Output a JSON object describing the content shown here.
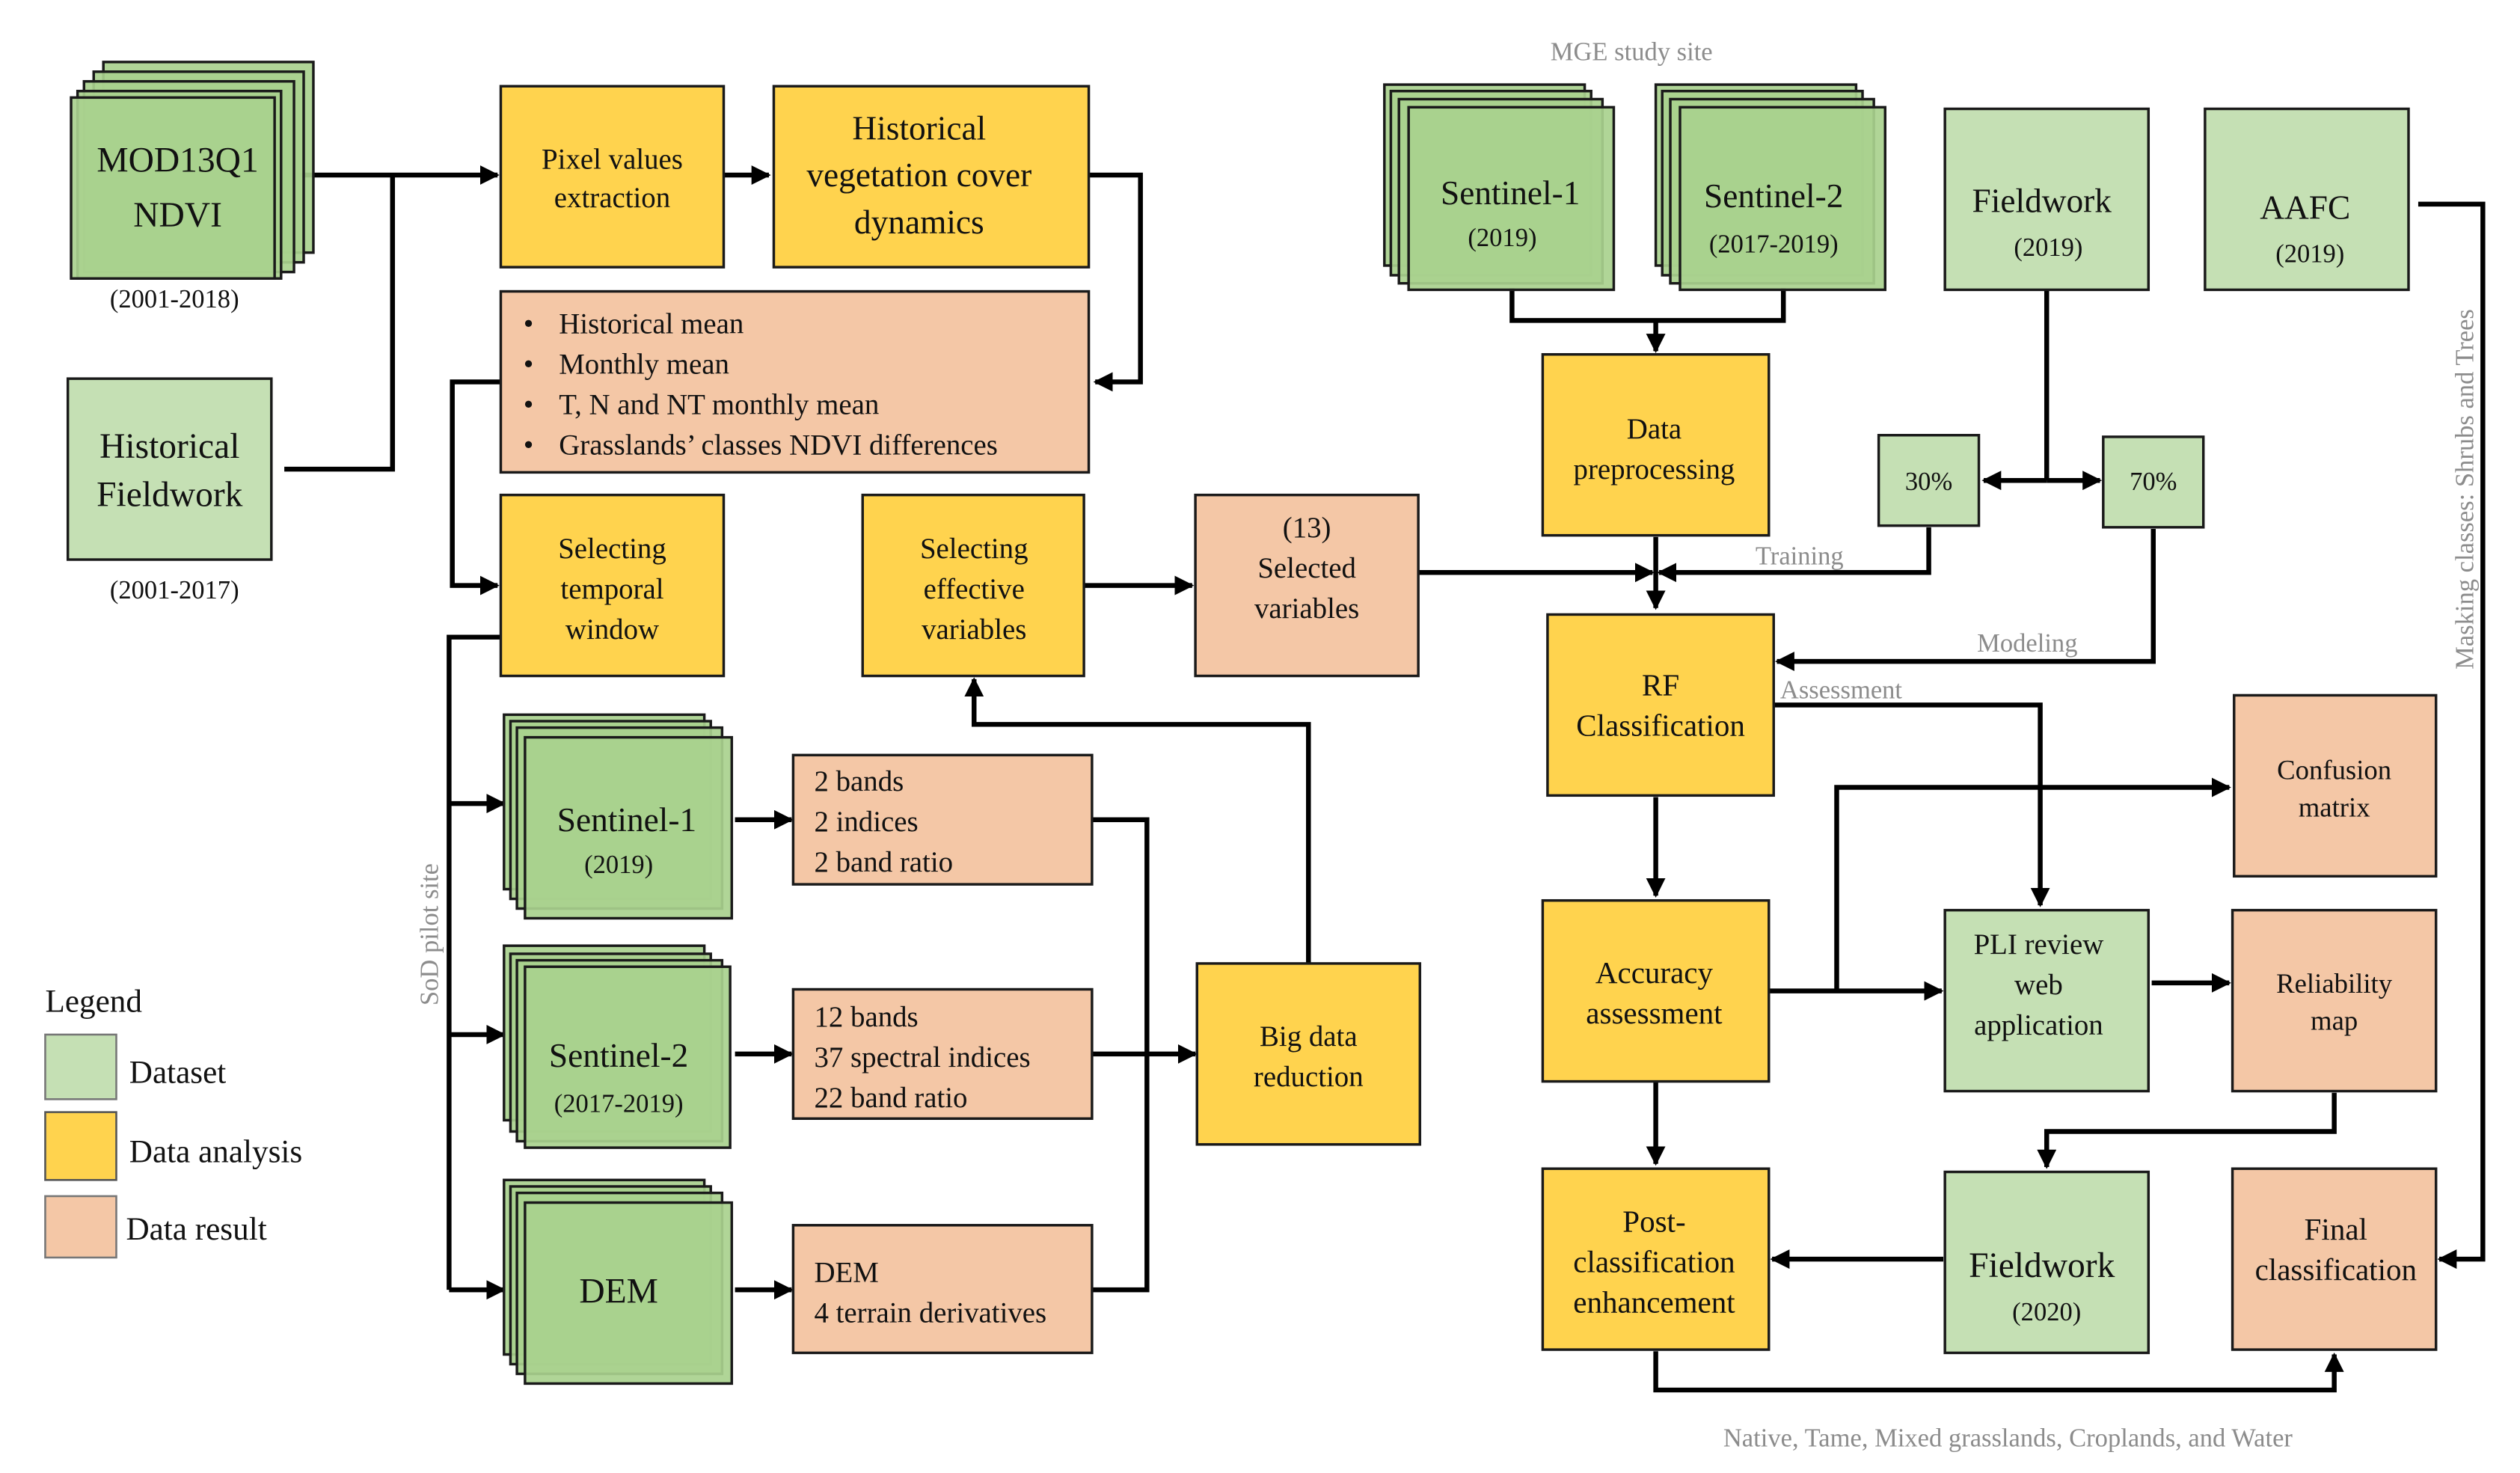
{
  "colors": {
    "dataset": "#c5e0b4",
    "dataset_stack": "#a9d18e",
    "analysis": "#ffd34e",
    "result": "#f4c7a6",
    "annotation": "#8c8c8c"
  },
  "legend": {
    "title": "Legend",
    "items": [
      {
        "label": "Dataset",
        "category": "dataset"
      },
      {
        "label": "Data analysis",
        "category": "analysis"
      },
      {
        "label": "Data result",
        "category": "result"
      }
    ]
  },
  "site_labels": {
    "mge": "MGE  study site",
    "sod": "SoD pilot site"
  },
  "left": {
    "mod13q1": {
      "line1": "MOD13Q1",
      "line2": "NDVI",
      "caption": "(2001-2018)"
    },
    "hist_fieldwork": {
      "line1": "Historical",
      "line2": "Fieldwork",
      "caption": "(2001-2017)"
    },
    "pixel_values": {
      "line1": "Pixel values",
      "line2": "extraction"
    },
    "hist_veg": {
      "line1": "Historical",
      "line2": "vegetation  cover",
      "line3": "dynamics"
    },
    "hist_results": {
      "items": [
        "Historical mean",
        "Monthly mean",
        "T, N and NT monthly mean",
        "Grasslands’ classes NDVI differences"
      ]
    },
    "temporal_window": {
      "line1": "Selecting",
      "line2": "temporal",
      "line3": "window"
    },
    "effective_vars": {
      "line1": "Selecting",
      "line2": "effective",
      "line3": "variables"
    },
    "selected_vars": {
      "line1": "(13)",
      "line2": "Selected",
      "line3": "variables"
    },
    "s1": {
      "line1": "Sentinel-1",
      "line2": "(2019)"
    },
    "s1_result": {
      "items": [
        "2 bands",
        "2 indices",
        "2 band ratio"
      ]
    },
    "s2": {
      "line1": "Sentinel-2",
      "line2": "(2017-2019)"
    },
    "s2_result": {
      "items": [
        "12 bands",
        "37 spectral indices",
        "22 band ratio"
      ]
    },
    "dem": {
      "line1": "DEM"
    },
    "dem_result": {
      "items": [
        "DEM",
        "4 terrain derivatives"
      ]
    },
    "big_data": {
      "line1": "Big data",
      "line2": "reduction"
    }
  },
  "right": {
    "s1": {
      "line1": "Sentinel-1",
      "line2": "(2019)"
    },
    "s2": {
      "line1": "Sentinel-2",
      "line2": "(2017-2019)"
    },
    "fieldwork2019": {
      "line1": "Fieldwork",
      "line2": "(2019)"
    },
    "aafc": {
      "line1": "AAFC",
      "line2": "(2019)"
    },
    "preprocessing": {
      "line1": "Data",
      "line2": "preprocessing"
    },
    "split30": {
      "label": "30%"
    },
    "split70": {
      "label": "70%"
    },
    "rf": {
      "line1": "RF",
      "line2": "Classification"
    },
    "accuracy": {
      "line1": "Accuracy",
      "line2": "assessment"
    },
    "confusion": {
      "line1": "Confusion",
      "line2": "matrix"
    },
    "pli": {
      "line1": "PLI review",
      "line2": "web",
      "line3": "application"
    },
    "reliability": {
      "line1": "Reliability",
      "line2": "map"
    },
    "postclass": {
      "line1": "Post-",
      "line2": "classification",
      "line3": "enhancement"
    },
    "fieldwork2020": {
      "line1": "Fieldwork",
      "line2": "(2020)"
    },
    "final": {
      "line1": "Final",
      "line2": "classification"
    }
  },
  "edge_labels": {
    "training": "Training",
    "modeling": "Modeling",
    "assessment": "Assessment",
    "masking": "Masking classes: Shrubs and Trees",
    "final_classes": "Native, Tame, Mixed grasslands, Croplands, and Water"
  }
}
